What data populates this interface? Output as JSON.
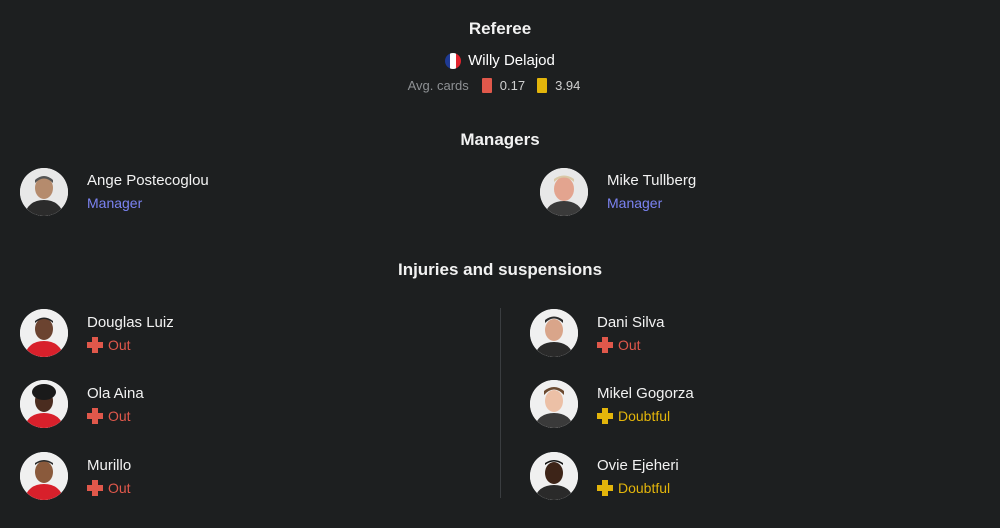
{
  "referee": {
    "title": "Referee",
    "name": "Willy Delajod",
    "avg_cards_label": "Avg. cards",
    "red_cards": "0.17",
    "yellow_cards": "3.94",
    "flag_colors": [
      "#1f3a93",
      "#ffffff",
      "#e0242f"
    ]
  },
  "managers": {
    "title": "Managers",
    "home": {
      "name": "Ange Postecoglou",
      "role": "Manager"
    },
    "away": {
      "name": "Mike Tullberg",
      "role": "Manager"
    }
  },
  "injuries": {
    "title": "Injuries and suspensions",
    "home": [
      {
        "name": "Douglas Luiz",
        "status": "Out",
        "status_type": "out"
      },
      {
        "name": "Ola Aina",
        "status": "Out",
        "status_type": "out"
      },
      {
        "name": "Murillo",
        "status": "Out",
        "status_type": "out"
      }
    ],
    "away": [
      {
        "name": "Dani Silva",
        "status": "Out",
        "status_type": "out"
      },
      {
        "name": "Mikel Gogorza",
        "status": "Doubtful",
        "status_type": "doubtful"
      },
      {
        "name": "Ovie Ejeheri",
        "status": "Doubtful",
        "status_type": "doubtful"
      }
    ]
  },
  "colors": {
    "background": "#1d1f20",
    "role_accent": "#7b83f2",
    "out": "#e0584b",
    "doubtful": "#e3b50b"
  }
}
